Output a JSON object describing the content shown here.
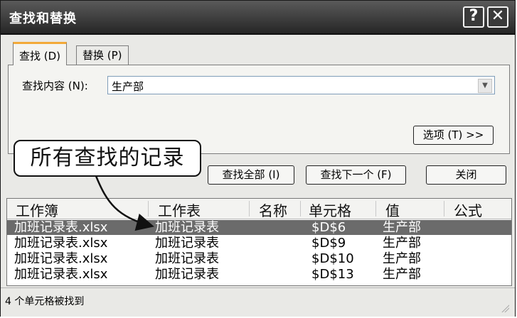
{
  "window": {
    "title": "查找和替换",
    "help_label": "?",
    "close_label": "✕"
  },
  "tabs": [
    {
      "label": "查找 (D)",
      "active": true
    },
    {
      "label": "替换 (P)",
      "active": false
    }
  ],
  "find": {
    "label": "查找内容 (N):",
    "value": "生产部"
  },
  "buttons": {
    "options": "选项 (T) >>",
    "find_all": "查找全部 (I)",
    "find_next": "查找下一个 (F)",
    "close": "关闭"
  },
  "callout": "所有查找的记录",
  "results": {
    "columns": [
      "工作簿",
      "工作表",
      "名称",
      "单元格",
      "值",
      "公式"
    ],
    "rows": [
      {
        "workbook": "加班记录表.xlsx",
        "sheet": "加班记录表",
        "name": "",
        "cell": "$D$6",
        "value": "生产部",
        "formula": "",
        "selected": true
      },
      {
        "workbook": "加班记录表.xlsx",
        "sheet": "加班记录表",
        "name": "",
        "cell": "$D$9",
        "value": "生产部",
        "formula": "",
        "selected": false
      },
      {
        "workbook": "加班记录表.xlsx",
        "sheet": "加班记录表",
        "name": "",
        "cell": "$D$10",
        "value": "生产部",
        "formula": "",
        "selected": false
      },
      {
        "workbook": "加班记录表.xlsx",
        "sheet": "加班记录表",
        "name": "",
        "cell": "$D$13",
        "value": "生产部",
        "formula": "",
        "selected": false
      }
    ]
  },
  "status": "4 个单元格被找到",
  "colors": {
    "titlebar": "#2e2e2e",
    "selected_row": "#6b6b6b",
    "tab_accent": "#f3a938"
  }
}
